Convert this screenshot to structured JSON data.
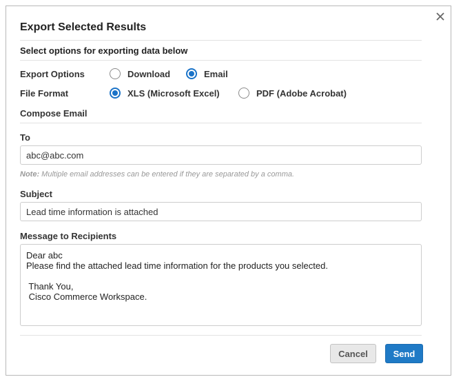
{
  "dialog": {
    "title": "Export Selected Results",
    "subtitle": "Select options for exporting data below",
    "close_icon": "close-icon"
  },
  "export_options": {
    "label": "Export Options",
    "options": [
      {
        "label": "Download",
        "checked": false
      },
      {
        "label": "Email",
        "checked": true
      }
    ]
  },
  "file_format": {
    "label": "File Format",
    "options": [
      {
        "label": "XLS (Microsoft Excel)",
        "checked": true
      },
      {
        "label": "PDF (Adobe Acrobat)",
        "checked": false
      }
    ]
  },
  "compose": {
    "heading": "Compose Email",
    "to_label": "To",
    "to_value": "abc@abc.com",
    "note_prefix": "Note:",
    "note_text": " Multiple email addresses can be entered if they are separated by a comma.",
    "subject_label": "Subject",
    "subject_value": "Lead time information is attached",
    "message_label": "Message to Recipients",
    "message_lines": [
      "Dear abc",
      "Please find the attached lead time information for the products you selected.",
      "",
      " Thank You,",
      " Cisco Commerce Workspace."
    ]
  },
  "buttons": {
    "cancel": "Cancel",
    "send": "Send"
  },
  "colors": {
    "accent": "#1f7ac6",
    "radio_checked": "#1a73c8"
  }
}
